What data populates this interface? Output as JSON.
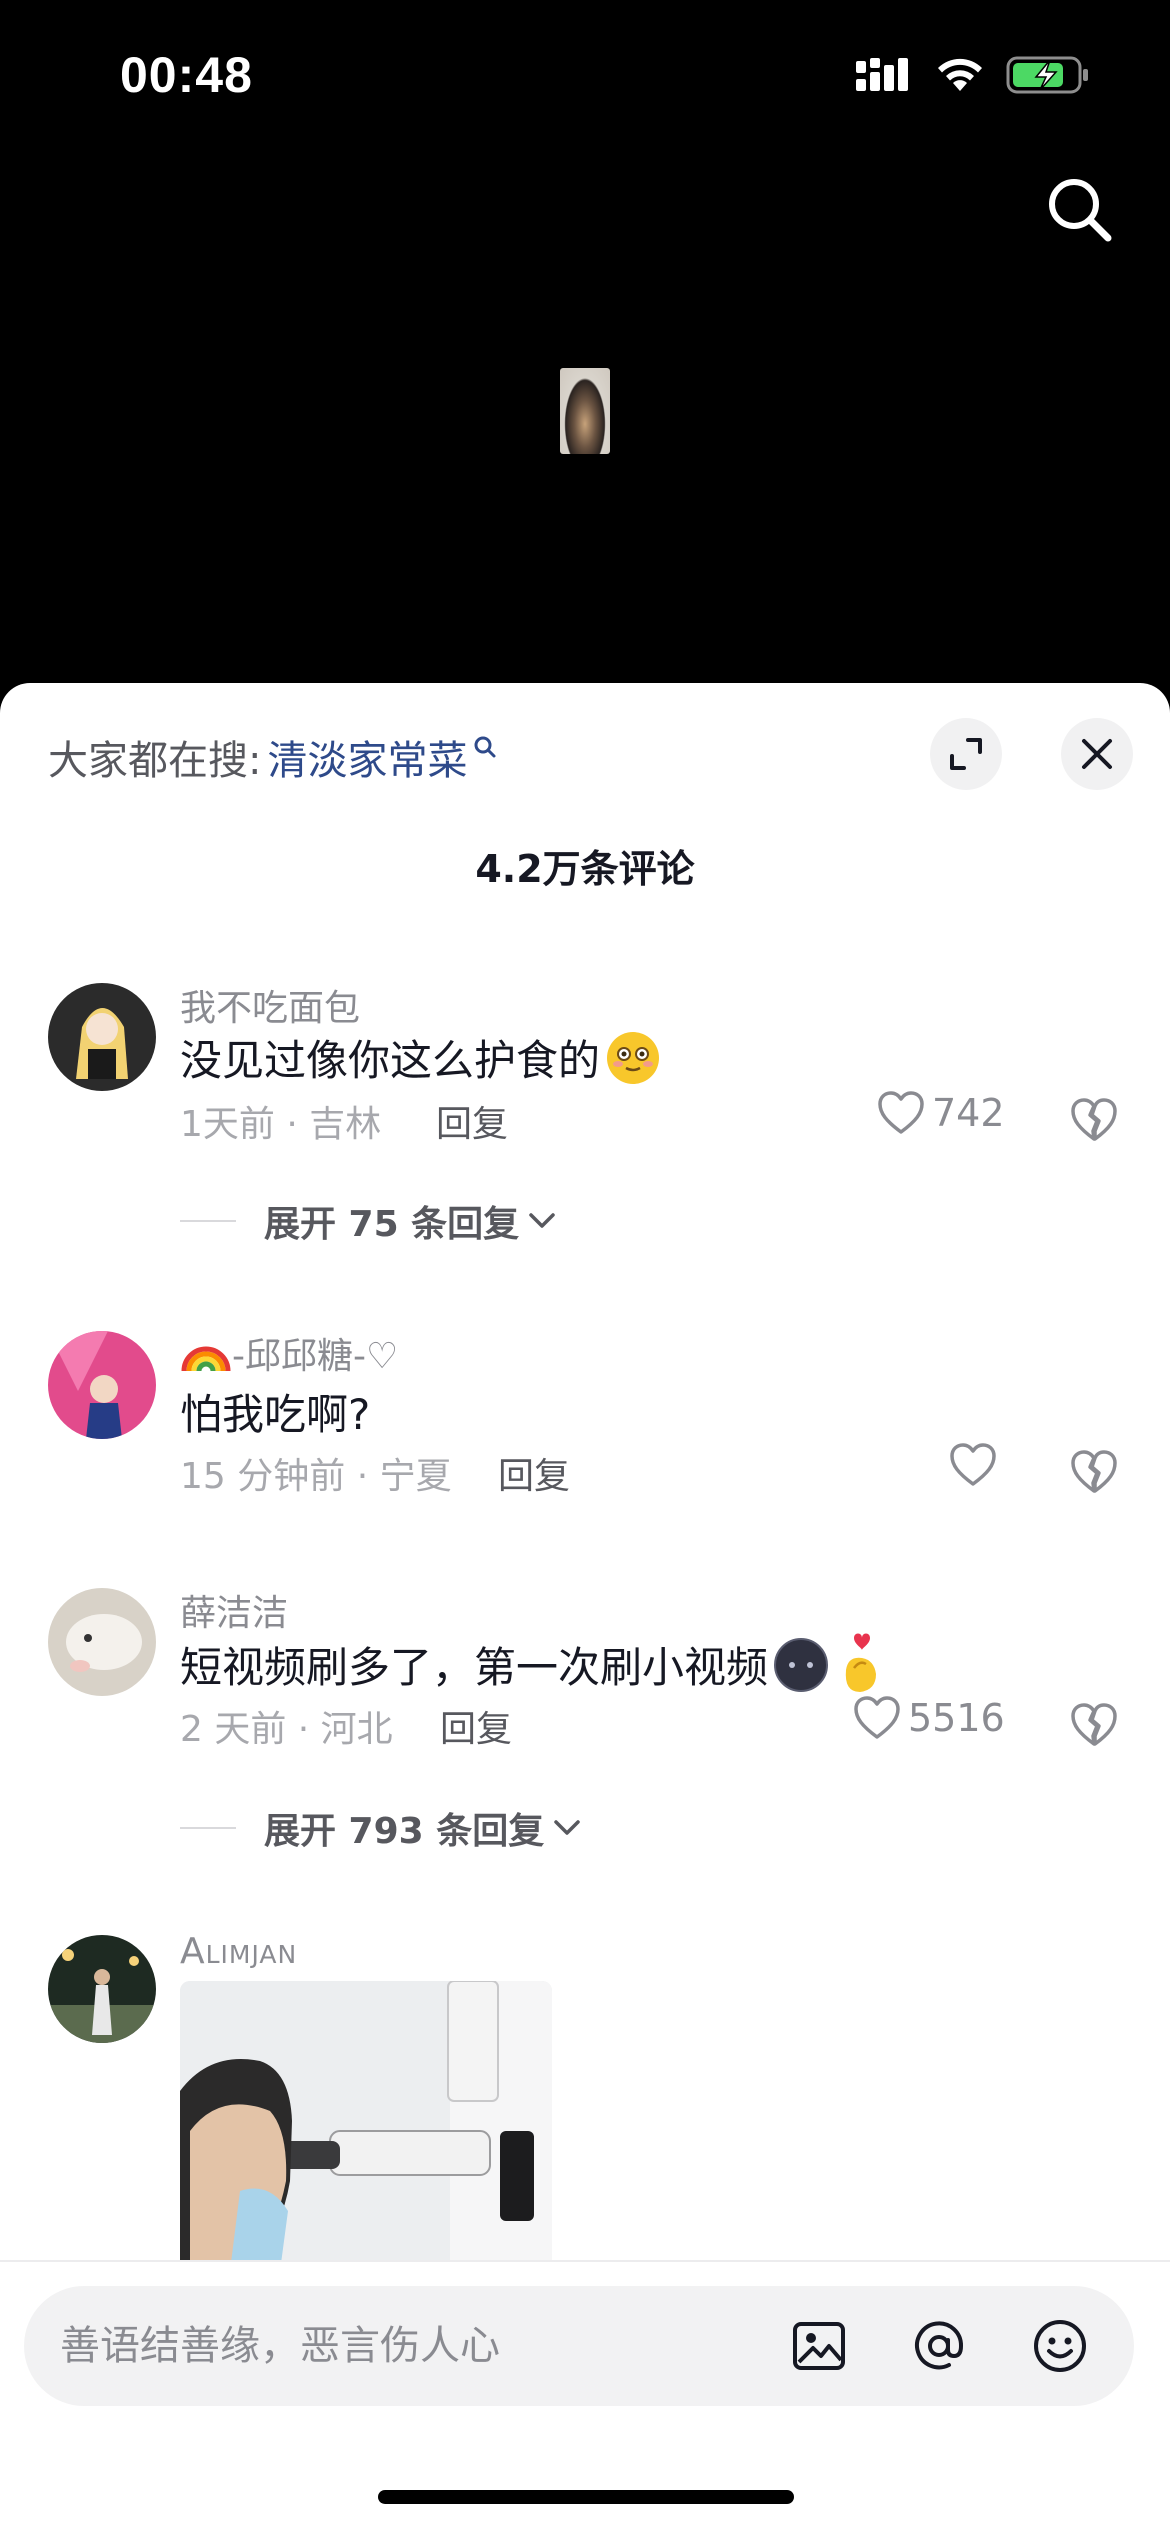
{
  "status_bar": {
    "time": "00:48"
  },
  "icons": {
    "signal": "cellular-signal-icon",
    "wifi": "wifi-icon",
    "battery": "battery-charging-icon",
    "search": "search-icon",
    "expand": "expand-icon",
    "close": "close-icon",
    "like": "heart-icon",
    "dislike": "broken-heart-icon",
    "image": "image-icon",
    "mention": "at-icon",
    "emoji": "emoji-icon"
  },
  "colors": {
    "accent_link": "#2e4a8a",
    "battery_green": "#4cd964"
  },
  "panel": {
    "hot_search_prefix": "大家都在搜:",
    "hot_search_keyword": "清淡家常菜",
    "comment_count": "4.2万条评论"
  },
  "comments": [
    {
      "name": "我不吃面包",
      "text": "没见过像你这么护食的",
      "meta": "1天前 · 吉林",
      "reply_label": "回复",
      "likes": "742",
      "expand_label": "展开 75 条回复"
    },
    {
      "name": "-邱邱糖-♡",
      "text": "怕我吃啊?",
      "meta": "15 分钟前 · 宁夏",
      "reply_label": "回复",
      "likes": ""
    },
    {
      "name": "薛洁洁",
      "text": "短视频刷多了，第一次刷小视频",
      "meta": "2 天前 · 河北",
      "reply_label": "回复",
      "likes": "5516",
      "expand_label": "展开 793 条回复"
    },
    {
      "name": "Alimjan"
    }
  ],
  "input": {
    "placeholder": "善语结善缘，恶言伤人心"
  }
}
